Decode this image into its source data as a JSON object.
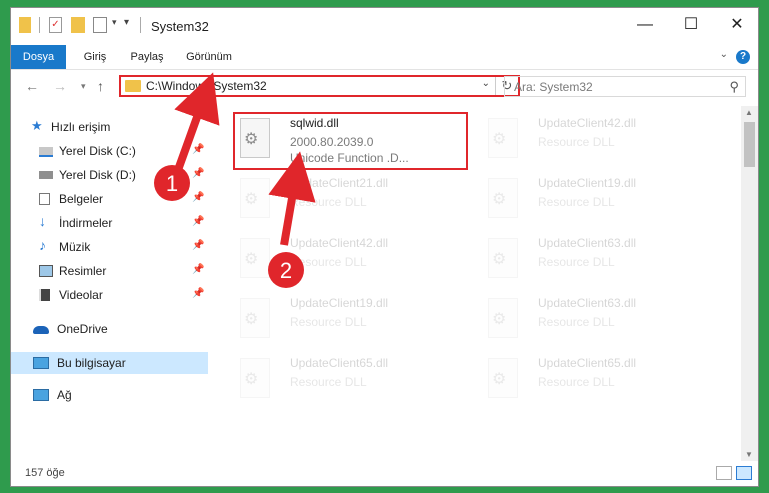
{
  "window": {
    "title": "System32",
    "controls": {
      "minimize": "—",
      "maximize": "☐",
      "close": "✕"
    }
  },
  "ribbon": {
    "tabs": [
      "Dosya",
      "Giriş",
      "Paylaş",
      "Görünüm"
    ],
    "help": "?"
  },
  "address": {
    "path": "C:\\Windows\\System32",
    "search_placeholder": "Ara: System32"
  },
  "sidebar": {
    "items": [
      {
        "label": "Hızlı erişim",
        "icon": "star-icon",
        "pinned": false
      },
      {
        "label": "Yerel Disk (C:)",
        "icon": "drive-icon",
        "pinned": true
      },
      {
        "label": "Yerel Disk (D:)",
        "icon": "drive-icon",
        "pinned": true
      },
      {
        "label": "Belgeler",
        "icon": "documents-icon",
        "pinned": true
      },
      {
        "label": "İndirmeler",
        "icon": "download-icon",
        "pinned": true
      },
      {
        "label": "Müzik",
        "icon": "music-icon",
        "pinned": true
      },
      {
        "label": "Resimler",
        "icon": "pictures-icon",
        "pinned": true
      },
      {
        "label": "Videolar",
        "icon": "videos-icon",
        "pinned": true
      },
      {
        "label": "OneDrive",
        "icon": "cloud-icon",
        "pinned": false
      },
      {
        "label": "Bu bilgisayar",
        "icon": "computer-icon",
        "pinned": false,
        "selected": true
      },
      {
        "label": "Ağ",
        "icon": "network-icon",
        "pinned": false
      }
    ]
  },
  "files": {
    "main": {
      "name": "sqlwid.dll",
      "version": "2000.80.2039.0",
      "description": "Unicode Function .D..."
    },
    "faded": [
      {
        "name": "UpdateClient42.dll",
        "desc": "Resource DLL"
      },
      {
        "name": "UpdateClient21.dll",
        "desc": "Resource DLL"
      },
      {
        "name": "UpdateClient19.dll",
        "desc": "Resource DLL"
      },
      {
        "name": "UpdateClient42.dll",
        "desc": "Resource DLL"
      },
      {
        "name": "UpdateClient63.dll",
        "desc": "Resource DLL"
      },
      {
        "name": "UpdateClient19.dll",
        "desc": "Resource DLL"
      },
      {
        "name": "UpdateClient63.dll",
        "desc": "Resource DLL"
      },
      {
        "name": "UpdateClient65.dll",
        "desc": "Resource DLL"
      },
      {
        "name": "UpdateClient65.dll",
        "desc": "Resource DLL"
      }
    ]
  },
  "annotations": {
    "one": "1",
    "two": "2"
  },
  "status": {
    "count": "157 öğe"
  },
  "colors": {
    "accent": "#1979ca",
    "highlight": "#e0262b",
    "selected": "#cce8ff"
  }
}
